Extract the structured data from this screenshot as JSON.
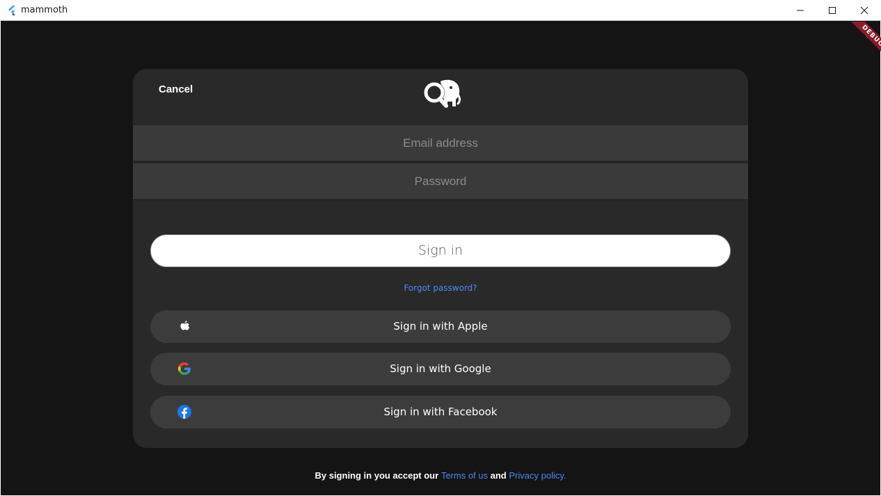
{
  "window": {
    "title": "mammoth",
    "debug_label": "DEBUG"
  },
  "header": {
    "cancel_label": "Cancel",
    "logo_icon": "mammoth-search-logo-icon"
  },
  "form": {
    "email_placeholder": "Email address",
    "email_value": "",
    "password_placeholder": "Password",
    "password_value": "",
    "signin_label": "Sign in",
    "forgot_label": "Forgot password?"
  },
  "social": [
    {
      "label": "Sign in with Apple",
      "icon": "apple-icon"
    },
    {
      "label": "Sign in with Google",
      "icon": "google-icon"
    },
    {
      "label": "Sign in with Facebook",
      "icon": "facebook-icon"
    }
  ],
  "footer": {
    "prefix": "By signing in you accept our",
    "terms_label": "Terms of us",
    "and_label": "and",
    "privacy_label": "Privacy policy."
  },
  "colors": {
    "background": "#141414",
    "card": "#292929",
    "field": "#3a3a3a",
    "link": "#4a8af4",
    "debug_ribbon": "#8b1a2a"
  }
}
